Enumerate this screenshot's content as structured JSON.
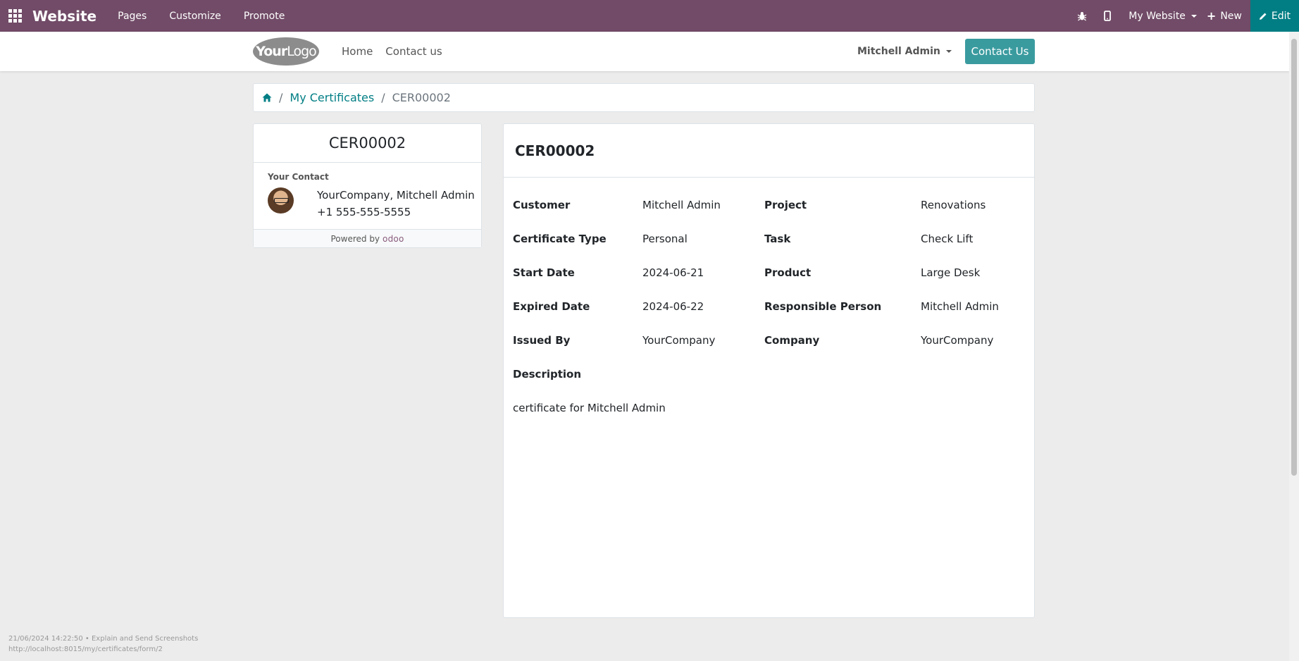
{
  "topbar": {
    "brand": "Website",
    "nav": [
      "Pages",
      "Customize",
      "Promote"
    ],
    "website_selector": "My Website",
    "new_label": "New",
    "edit_label": "Edit"
  },
  "header": {
    "logo_text_bold": "Your",
    "logo_text_light": "Logo",
    "nav": [
      "Home",
      "Contact us"
    ],
    "user": "Mitchell Admin",
    "contact_button": "Contact Us"
  },
  "breadcrumb": {
    "parent": "My Certificates",
    "current": "CER00002"
  },
  "sidebar": {
    "title": "CER00002",
    "contact_label": "Your Contact",
    "contact_name": "YourCompany, Mitchell Admin",
    "contact_phone": "+1 555-555-5555",
    "powered_by": "Powered by",
    "powered_brand": "odoo"
  },
  "certificate": {
    "title": "CER00002",
    "fields": {
      "customer": {
        "label": "Customer",
        "value": "Mitchell Admin"
      },
      "project": {
        "label": "Project",
        "value": "Renovations"
      },
      "certificate_type": {
        "label": "Certificate Type",
        "value": "Personal"
      },
      "task": {
        "label": "Task",
        "value": "Check Lift"
      },
      "start_date": {
        "label": "Start Date",
        "value": "2024-06-21"
      },
      "product": {
        "label": "Product",
        "value": "Large Desk"
      },
      "expired_date": {
        "label": "Expired Date",
        "value": "2024-06-22"
      },
      "responsible": {
        "label": "Responsible Person",
        "value": "Mitchell Admin"
      },
      "issued_by": {
        "label": "Issued By",
        "value": "YourCompany"
      },
      "company": {
        "label": "Company",
        "value": "YourCompany"
      }
    },
    "description_label": "Description",
    "description": "certificate for Mitchell Admin"
  },
  "overlay": {
    "line1": "21/06/2024 14:22:50 • Explain and Send Screenshots",
    "line2": "http://localhost:8015/my/certificates/form/2"
  },
  "colors": {
    "topbar": "#714b67",
    "accent": "#017e84",
    "contact_button": "#3a9b9f"
  }
}
